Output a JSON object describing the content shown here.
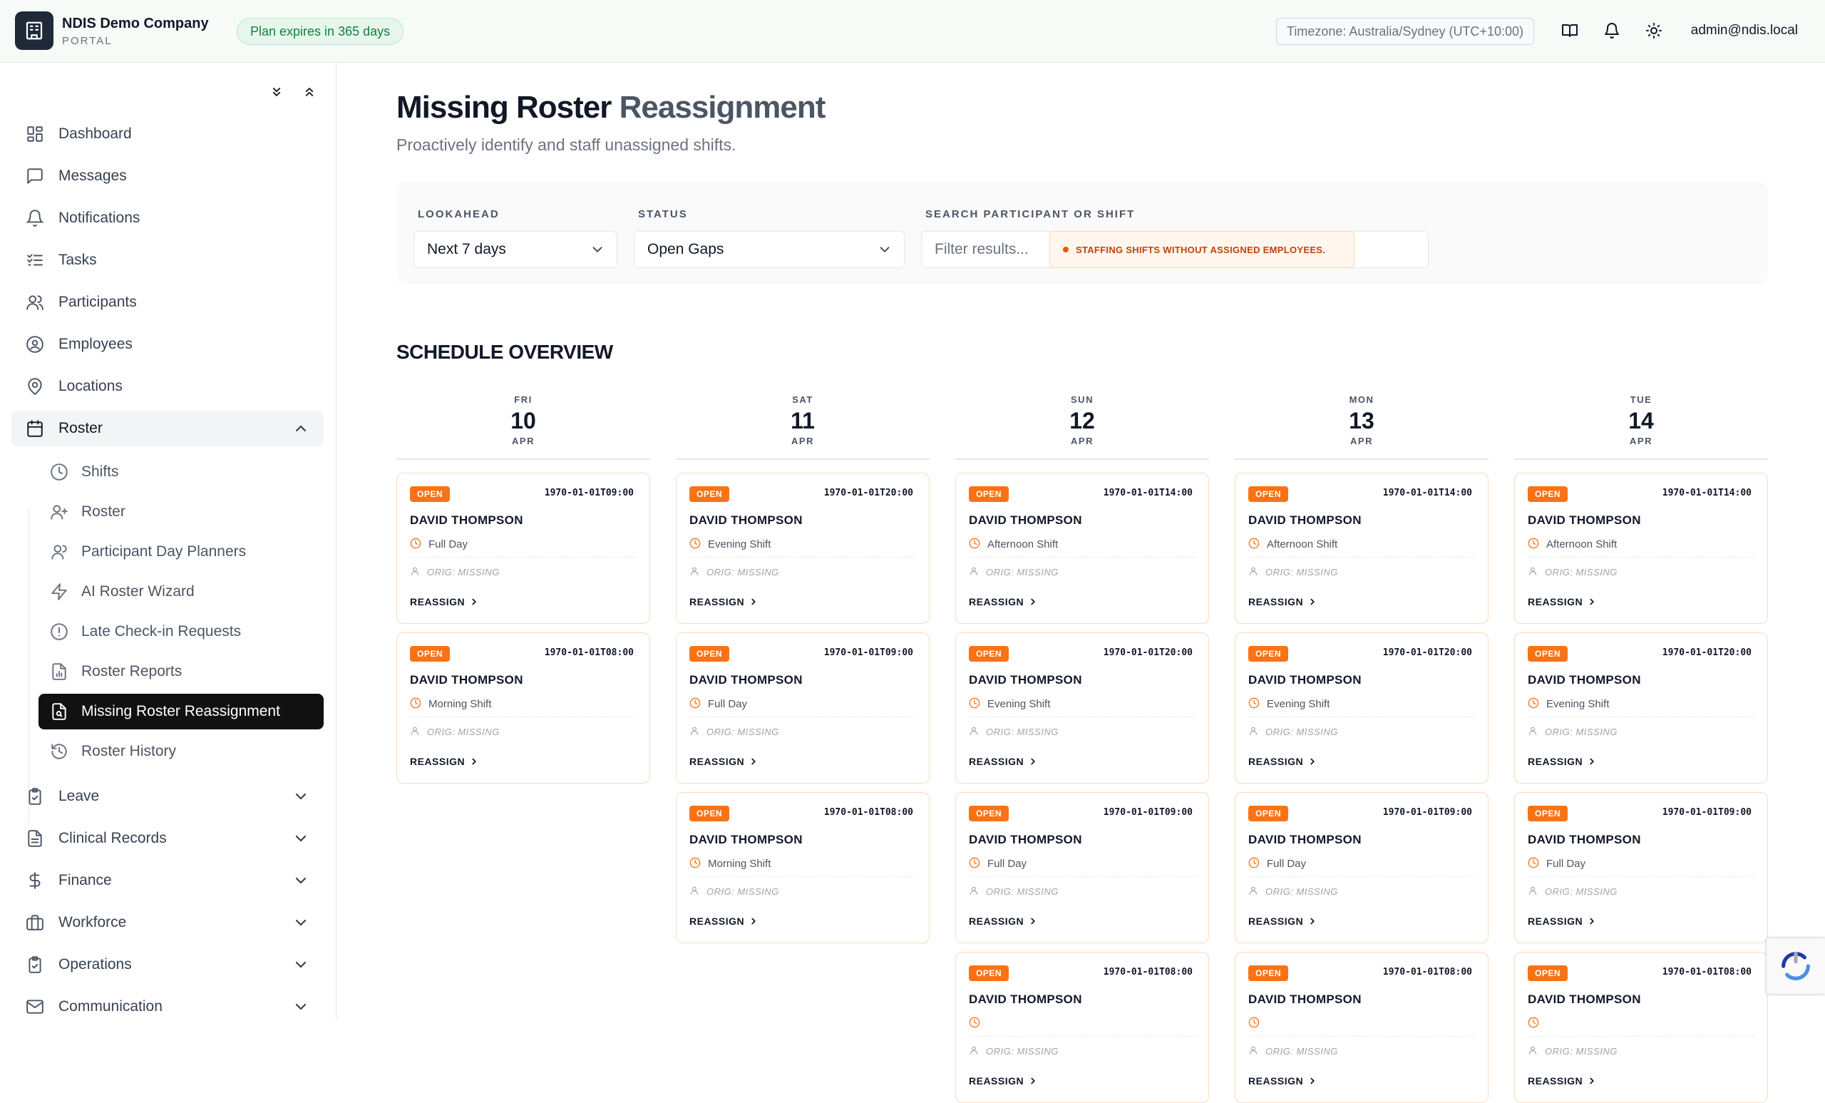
{
  "header": {
    "company_name": "NDIS Demo Company",
    "company_sub": "PORTAL",
    "plan_badge": "Plan expires in 365 days",
    "timezone": "Timezone: Australia/Sydney (UTC+10:00)",
    "user": "admin@ndis.local"
  },
  "sidebar": {
    "items": [
      {
        "label": "Dashboard",
        "icon": "dashboard-icon"
      },
      {
        "label": "Messages",
        "icon": "message-icon"
      },
      {
        "label": "Notifications",
        "icon": "bell-icon"
      },
      {
        "label": "Tasks",
        "icon": "tasks-icon"
      },
      {
        "label": "Participants",
        "icon": "users-icon"
      },
      {
        "label": "Employees",
        "icon": "user-circle-icon"
      },
      {
        "label": "Locations",
        "icon": "map-pin-icon"
      },
      {
        "label": "Roster",
        "icon": "calendar-icon"
      }
    ],
    "roster_sub": [
      {
        "label": "Shifts",
        "icon": "clock-icon"
      },
      {
        "label": "Roster",
        "icon": "user-plus-icon"
      },
      {
        "label": "Participant Day Planners",
        "icon": "user-icon"
      },
      {
        "label": "AI Roster Wizard",
        "icon": "lightning-icon"
      },
      {
        "label": "Late Check-in Requests",
        "icon": "alert-circle-icon"
      },
      {
        "label": "Roster Reports",
        "icon": "report-icon"
      },
      {
        "label": "Missing Roster Reassignment",
        "icon": "file-search-icon"
      },
      {
        "label": "Roster History",
        "icon": "history-icon"
      }
    ],
    "groups": [
      {
        "label": "Leave",
        "icon": "clipboard-check-icon"
      },
      {
        "label": "Clinical Records",
        "icon": "document-icon"
      },
      {
        "label": "Finance",
        "icon": "dollar-icon"
      },
      {
        "label": "Workforce",
        "icon": "briefcase-icon"
      },
      {
        "label": "Operations",
        "icon": "clipboard-icon"
      },
      {
        "label": "Communication",
        "icon": "mail-icon"
      }
    ]
  },
  "main": {
    "title_dark": "Missing Roster",
    "title_light": "Reassignment",
    "subtitle": "Proactively identify and staff unassigned shifts.",
    "filters": {
      "lookahead_label": "LOOKAHEAD",
      "lookahead_value": "Next 7 days",
      "status_label": "STATUS",
      "status_value": "Open Gaps",
      "search_label": "SEARCH PARTICIPANT OR SHIFT",
      "search_placeholder": "Filter results...",
      "alert": "STAFFING SHIFTS WITHOUT ASSIGNED EMPLOYEES."
    },
    "section_title": "SCHEDULE OVERVIEW",
    "badge_label": "OPEN",
    "orig_label": "ORIG: MISSING",
    "reassign_label": "REASSIGN",
    "days": [
      {
        "dow": "FRI",
        "num": "10",
        "mon": "APR",
        "shifts": [
          {
            "time": "1970-01-01T09:00",
            "participant": "DAVID THOMPSON",
            "type": "Full Day"
          },
          {
            "time": "1970-01-01T08:00",
            "participant": "DAVID THOMPSON",
            "type": "Morning Shift"
          }
        ]
      },
      {
        "dow": "SAT",
        "num": "11",
        "mon": "APR",
        "shifts": [
          {
            "time": "1970-01-01T20:00",
            "participant": "DAVID THOMPSON",
            "type": "Evening Shift"
          },
          {
            "time": "1970-01-01T09:00",
            "participant": "DAVID THOMPSON",
            "type": "Full Day"
          },
          {
            "time": "1970-01-01T08:00",
            "participant": "DAVID THOMPSON",
            "type": "Morning Shift"
          }
        ]
      },
      {
        "dow": "SUN",
        "num": "12",
        "mon": "APR",
        "shifts": [
          {
            "time": "1970-01-01T14:00",
            "participant": "DAVID THOMPSON",
            "type": "Afternoon Shift"
          },
          {
            "time": "1970-01-01T20:00",
            "participant": "DAVID THOMPSON",
            "type": "Evening Shift"
          },
          {
            "time": "1970-01-01T09:00",
            "participant": "DAVID THOMPSON",
            "type": "Full Day"
          },
          {
            "time": "1970-01-01T08:00",
            "participant": "DAVID THOMPSON",
            "type": ""
          }
        ]
      },
      {
        "dow": "MON",
        "num": "13",
        "mon": "APR",
        "shifts": [
          {
            "time": "1970-01-01T14:00",
            "participant": "DAVID THOMPSON",
            "type": "Afternoon Shift"
          },
          {
            "time": "1970-01-01T20:00",
            "participant": "DAVID THOMPSON",
            "type": "Evening Shift"
          },
          {
            "time": "1970-01-01T09:00",
            "participant": "DAVID THOMPSON",
            "type": "Full Day"
          },
          {
            "time": "1970-01-01T08:00",
            "participant": "DAVID THOMPSON",
            "type": ""
          }
        ]
      },
      {
        "dow": "TUE",
        "num": "14",
        "mon": "APR",
        "shifts": [
          {
            "time": "1970-01-01T14:00",
            "participant": "DAVID THOMPSON",
            "type": "Afternoon Shift"
          },
          {
            "time": "1970-01-01T20:00",
            "participant": "DAVID THOMPSON",
            "type": "Evening Shift"
          },
          {
            "time": "1970-01-01T09:00",
            "participant": "DAVID THOMPSON",
            "type": "Full Day"
          },
          {
            "time": "1970-01-01T08:00",
            "participant": "DAVID THOMPSON",
            "type": ""
          }
        ]
      }
    ]
  },
  "colors": {
    "accent": "#f97316",
    "active_nav": "#111111",
    "plan_badge": "#15803d"
  }
}
